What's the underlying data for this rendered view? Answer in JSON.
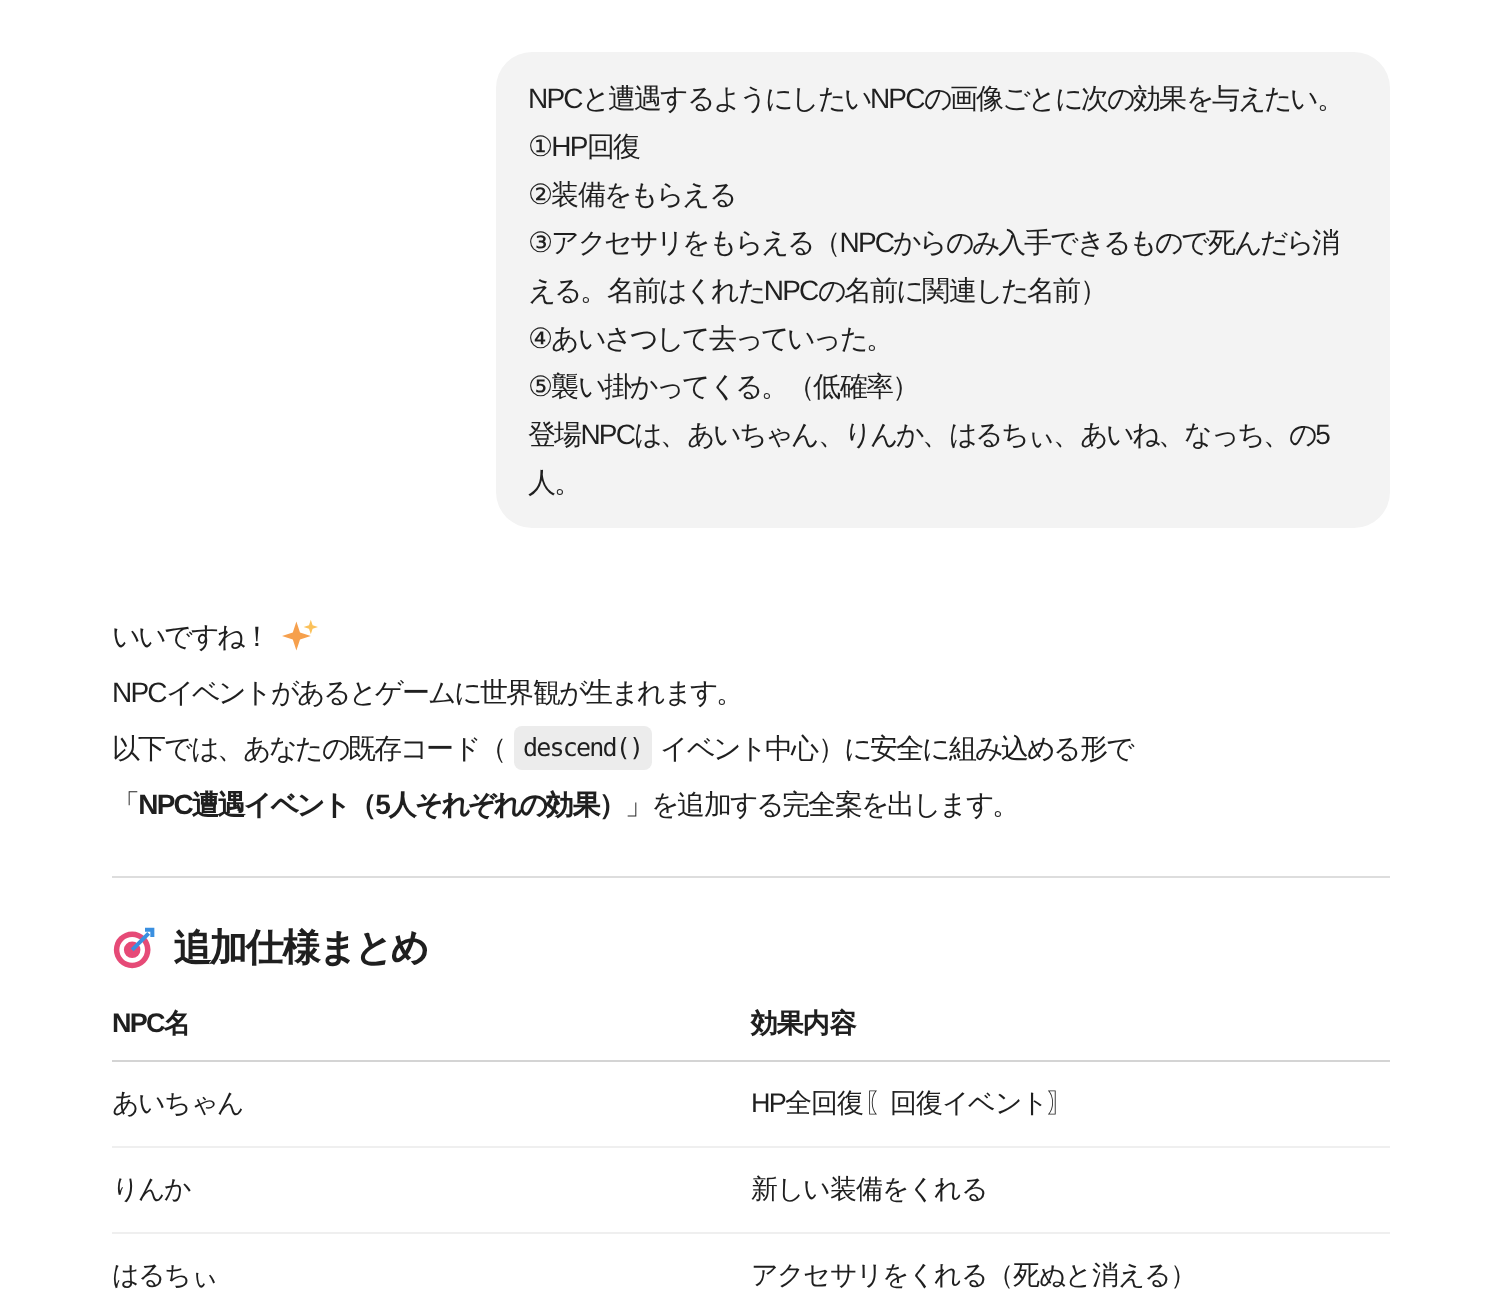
{
  "user_message": {
    "lines": [
      "NPCと遭遇するようにしたいNPCの画像ごとに次の効果を与えたい。",
      "①HP回復",
      "②装備をもらえる",
      "③アクセサリをもらえる（NPCからのみ入手できるもので死んだら消える。名前はくれたNPCの名前に関連した名前）",
      "④あいさつして去っていった。",
      "⑤襲い掛かってくる。（低確率）",
      "登場NPCは、あいちゃん、りんか、はるちぃ、あいね、なっち、の5人。"
    ]
  },
  "reply": {
    "greeting": "いいですね！",
    "intro": "NPCイベントがあるとゲームに世界観が生まれます。",
    "code_line": {
      "before": "以下では、あなたの既存コード（",
      "code": "descend()",
      "after": "イベント中心）に安全に組み込める形で"
    },
    "proposal": "「**NPC遭遇イベント（5人それぞれの効果）**」を追加する完全案を出します。",
    "section_title": "追加仕様まとめ",
    "table": {
      "columns": [
        "NPC名",
        "効果内容"
      ],
      "rows": [
        [
          "あいちゃん",
          "HP全回復〖回復イベント〗"
        ],
        [
          "りんか",
          "新しい装備をくれる"
        ],
        [
          "はるちぃ",
          "アクセサリをくれる（死ぬと消える）"
        ]
      ]
    }
  }
}
